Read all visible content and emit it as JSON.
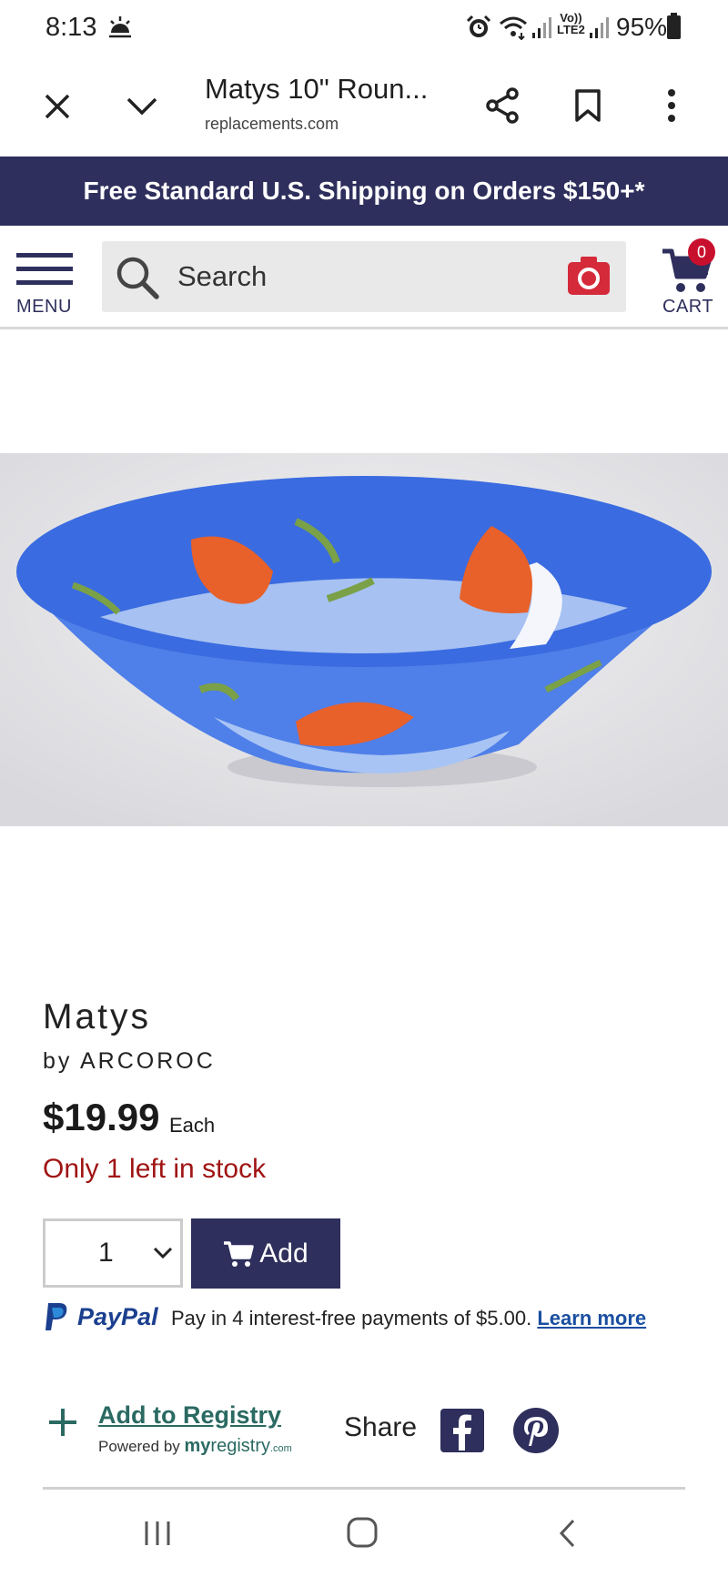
{
  "status_bar": {
    "time": "8:13",
    "network_label_top": "Vo))",
    "network_label_bottom": "LTE2",
    "battery": "95%"
  },
  "browser": {
    "page_title": "Matys 10\" Roun...",
    "domain": "replacements.com",
    "icons": [
      "close-icon",
      "chevron-down-icon",
      "share-icon",
      "bookmark-icon",
      "more-vert-icon"
    ]
  },
  "promo": {
    "text": "Free Standard U.S. Shipping on Orders $150+*"
  },
  "header": {
    "menu_label": "MENU",
    "search_placeholder": "Search",
    "cart_label": "CART",
    "cart_count": "0",
    "accent_color": "#2e2f5c",
    "camera_color": "#d42a3a"
  },
  "product": {
    "name": "Matys",
    "brand": "by ARCOROC",
    "price": "$19.99",
    "price_unit": "Each",
    "stock_status": "Only 1 left in stock",
    "quantity": "1",
    "add_label": "Add"
  },
  "paypal": {
    "logo_text": "PayPal",
    "message": "Pay in 4 interest-free payments of $5.00.",
    "learn_more": "Learn more"
  },
  "registry": {
    "link_text": "Add to Registry",
    "powered_by": "Powered by",
    "brand_my": "my",
    "brand_registry": "registry",
    "brand_com": ".com"
  },
  "share": {
    "label": "Share"
  }
}
